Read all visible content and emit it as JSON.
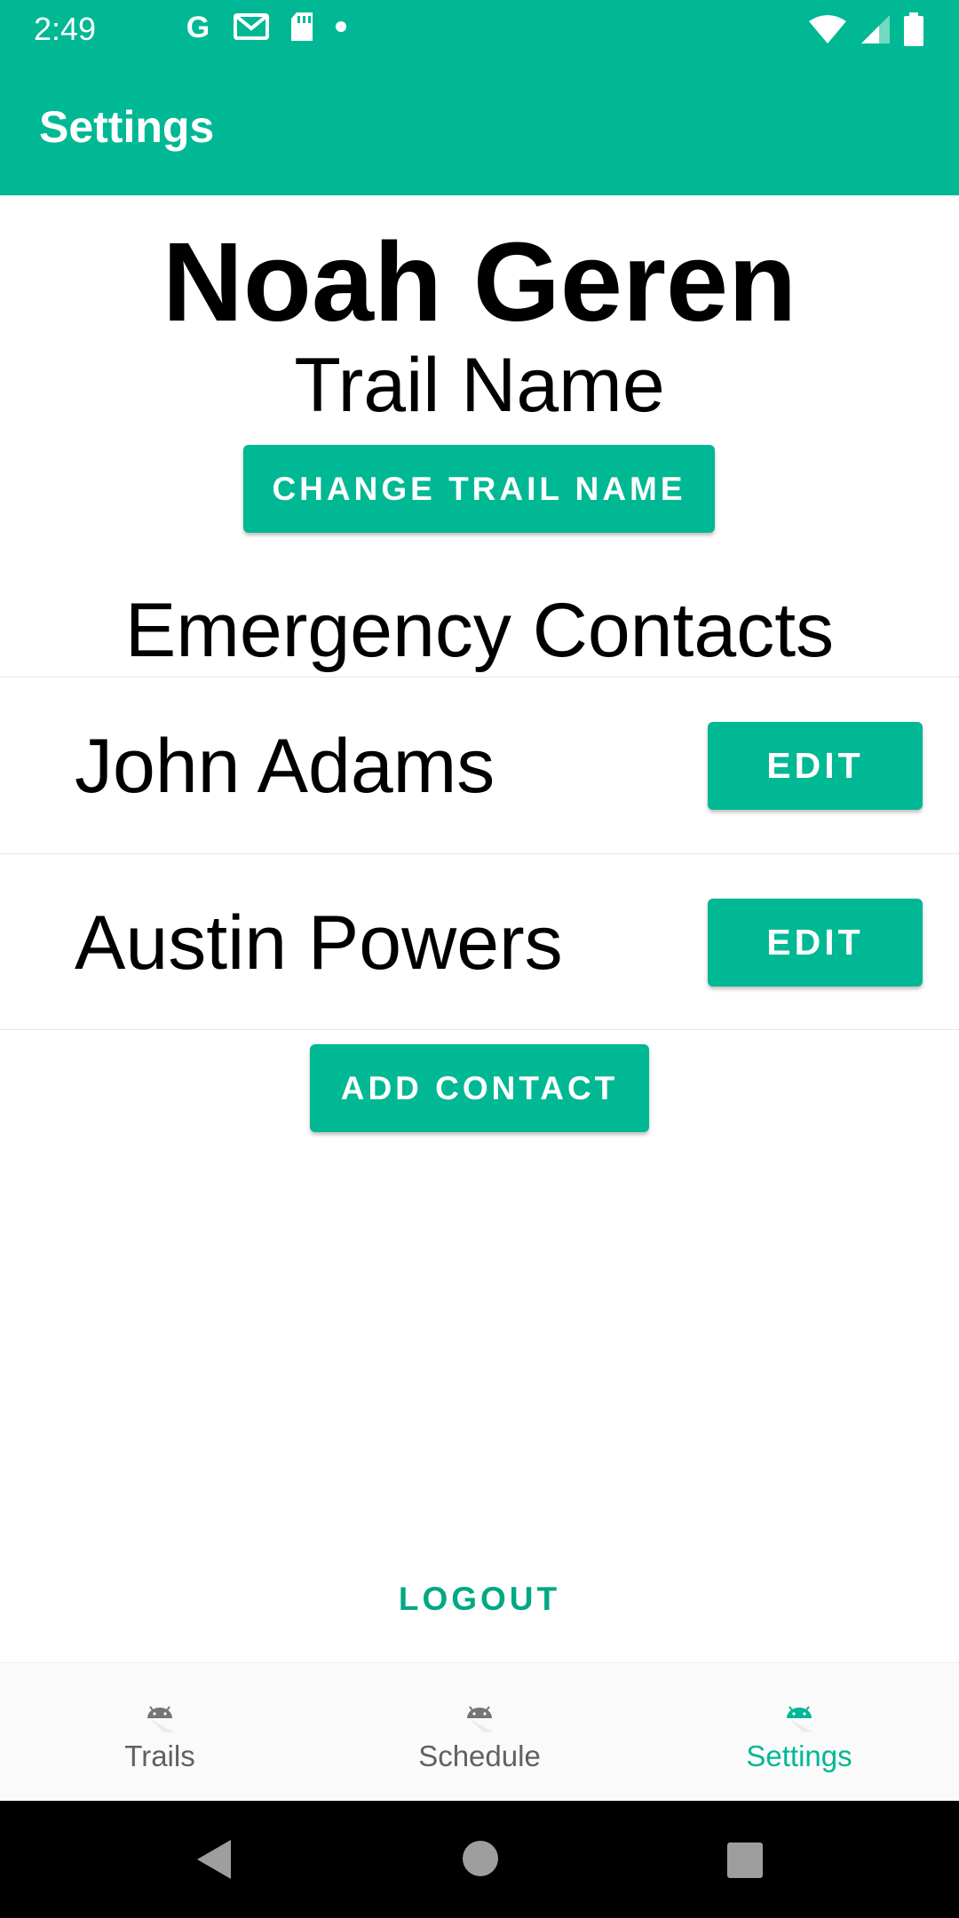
{
  "status_bar": {
    "time": "2:49",
    "left_icons": [
      "google-icon",
      "gmail-icon",
      "sd-card-icon",
      "notification-dot-icon"
    ],
    "right_icons": [
      "wifi-icon",
      "cellular-signal-icon",
      "battery-icon"
    ]
  },
  "app_bar": {
    "title": "Settings"
  },
  "profile": {
    "name": "Noah Geren",
    "trail_name": "Trail Name",
    "change_trail_name_label": "CHANGE TRAIL NAME"
  },
  "emergency_contacts": {
    "title": "Emergency Contacts",
    "contacts": [
      {
        "name": "John Adams",
        "edit_label": "EDIT"
      },
      {
        "name": "Austin Powers",
        "edit_label": "EDIT"
      }
    ],
    "add_contact_label": "ADD CONTACT"
  },
  "logout_label": "LOGOUT",
  "bottom_nav": {
    "items": [
      {
        "label": "Trails",
        "icon": "android-icon",
        "active": false
      },
      {
        "label": "Schedule",
        "icon": "android-icon",
        "active": false
      },
      {
        "label": "Settings",
        "icon": "android-icon",
        "active": true
      }
    ]
  },
  "colors": {
    "accent": "#00b894",
    "inactive_nav": "#616161"
  }
}
